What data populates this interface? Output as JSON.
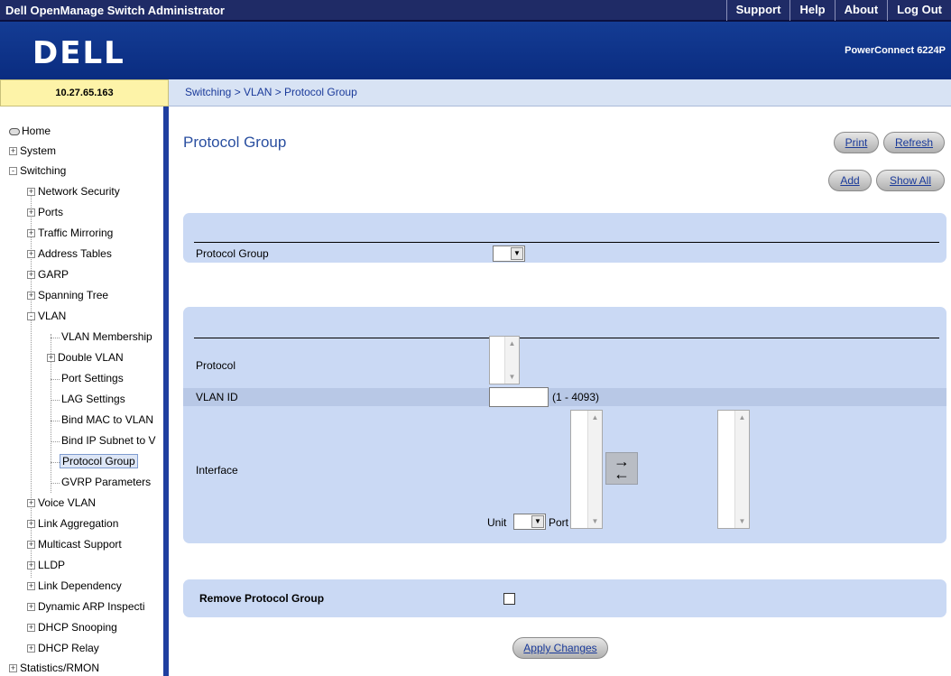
{
  "header": {
    "app_title": "Dell OpenManage Switch Administrator",
    "nav": [
      "Support",
      "Help",
      "About",
      "Log Out"
    ],
    "logo": "DELL",
    "model": "PowerConnect 6224P"
  },
  "ip_address": "10.27.65.163",
  "breadcrumb": "Switching > VLAN > Protocol Group",
  "sidebar": {
    "items": [
      {
        "label": "Home",
        "icon": "disk-icon"
      },
      {
        "label": "System",
        "expander": "+"
      },
      {
        "label": "Switching",
        "expander": "-"
      },
      {
        "label": "Network Security",
        "expander": "+"
      },
      {
        "label": "Ports",
        "expander": "+"
      },
      {
        "label": "Traffic Mirroring",
        "expander": "+"
      },
      {
        "label": "Address Tables",
        "expander": "+"
      },
      {
        "label": "GARP",
        "expander": "+"
      },
      {
        "label": "Spanning Tree",
        "expander": "+"
      },
      {
        "label": "VLAN",
        "expander": "-"
      },
      {
        "label": "VLAN Membership"
      },
      {
        "label": "Double VLAN",
        "expander": "+"
      },
      {
        "label": "Port Settings"
      },
      {
        "label": "LAG Settings"
      },
      {
        "label": "Bind MAC to VLAN"
      },
      {
        "label": "Bind IP Subnet to V"
      },
      {
        "label": "Protocol Group",
        "selected": true
      },
      {
        "label": "GVRP Parameters"
      },
      {
        "label": "Voice VLAN",
        "expander": "+"
      },
      {
        "label": "Link Aggregation",
        "expander": "+"
      },
      {
        "label": "Multicast Support",
        "expander": "+"
      },
      {
        "label": "LLDP",
        "expander": "+"
      },
      {
        "label": "Link Dependency",
        "expander": "+"
      },
      {
        "label": "Dynamic ARP Inspecti",
        "expander": "+"
      },
      {
        "label": "DHCP Snooping",
        "expander": "+"
      },
      {
        "label": "DHCP Relay",
        "expander": "+"
      },
      {
        "label": "Statistics/RMON",
        "expander": "+"
      }
    ]
  },
  "main": {
    "title": "Protocol Group",
    "buttons": {
      "print": "Print",
      "refresh": "Refresh",
      "add": "Add",
      "show_all": "Show All",
      "apply": "Apply Changes"
    },
    "protocol_group_label": "Protocol Group",
    "form": {
      "protocol_label": "Protocol",
      "vlan_id_label": "VLAN ID",
      "vlan_id_value": "",
      "vlan_id_range": "(1 - 4093)",
      "interface_label": "Interface",
      "unit_label": "Unit",
      "port_label": "Port"
    },
    "remove_label": "Remove Protocol Group"
  },
  "colors": {
    "topbar": "#1f2b66",
    "banner": "#143c94",
    "panel": "#cad9f4",
    "title": "#2a4fa0",
    "ip_bar": "#fdf3a8"
  }
}
